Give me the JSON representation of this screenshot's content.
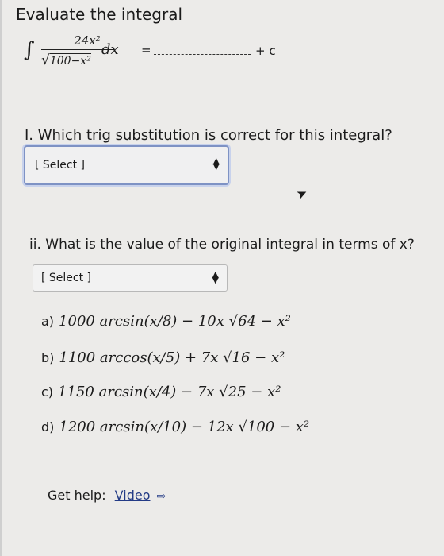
{
  "title": "Evaluate the integral",
  "integral": {
    "sign": "∫",
    "numerator": "24x²",
    "denominator_radical": "√",
    "denominator_inner": "100−x²",
    "dx": "dx",
    "equals": "=",
    "plus_c": "+ c"
  },
  "question1": {
    "text": "I. Which trig substitution is correct for this integral?",
    "select_value": "[ Select ]"
  },
  "question2": {
    "text": "ii. What is the value of the original integral in terms of x?",
    "select_value": "[ Select ]"
  },
  "options": [
    {
      "label": "a)",
      "expr": "1000 arcsin(x/8) − 10x √64 − x²"
    },
    {
      "label": "b)",
      "expr": "1100 arccos(x/5) + 7x √16 − x²"
    },
    {
      "label": "c)",
      "expr": "1150 arcsin(x/4) − 7x √25 − x²"
    },
    {
      "label": "d)",
      "expr": "1200 arcsin(x/10) − 12x √100 − x²"
    }
  ],
  "help": {
    "prefix": "Get help:",
    "link": "Video",
    "icon": "external-link-icon"
  },
  "cursor_icon": "mouse-pointer-icon",
  "colors": {
    "background": "#ecebe9",
    "select_focus": "#7e92c4",
    "link": "#233b86"
  }
}
